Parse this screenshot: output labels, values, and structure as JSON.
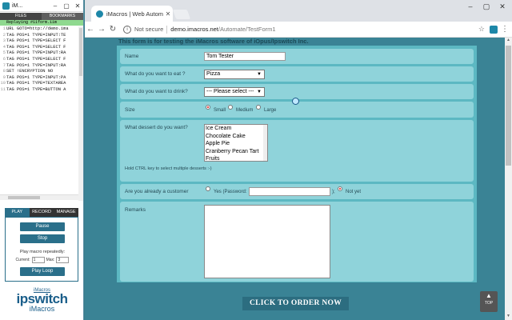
{
  "left_panel": {
    "title": "iM...",
    "tabs": [
      "FILES",
      "BOOKMARKS"
    ],
    "replay_line": "Replaying #11form.iim",
    "code_lines": [
      "URL GOTO=http://demo.ima",
      "TAG POS=1 TYPE=INPUT:TE",
      "TAG POS=1 TYPE=SELECT F",
      "TAG POS=1 TYPE=SELECT F",
      "TAG POS=1 TYPE=INPUT:RA",
      "TAG POS=1 TYPE=SELECT F",
      "TAG POS=1 TYPE=INPUT:RA",
      "SET !ENCRYPTION NO",
      "TAG POS=1 TYPE=INPUT:PA",
      "TAG POS=1 TYPE=TEXTAREA",
      "TAG POS=1 TYPE=BUTTON A"
    ],
    "line_numbers": [
      "1",
      "2",
      "3",
      "4",
      "5",
      "6",
      "7",
      "8",
      "9",
      "10",
      "11"
    ],
    "control_tabs": [
      "PLAY",
      "RECORD",
      "MANAGE"
    ],
    "pause_label": "Pause",
    "stop_label": "Stop",
    "play_repeat_label": "Play macro repeatedly:",
    "current_label": "Current:",
    "current_value": "1",
    "max_label": "Max:",
    "max_value": "3",
    "play_loop_label": "Play Loop",
    "brand_small": "iMacros",
    "brand_big": "ipswitch",
    "brand_sub": "iMacros"
  },
  "browser": {
    "tab_title": "iMacros | Web Automatio",
    "not_secure": "Not secure",
    "url_host": "demo.imacros.net",
    "url_path": "/Automate/TestForm1"
  },
  "form": {
    "intro": "This form is for testing the iMacros software of iOpus/Ipswitch Inc.",
    "name_label": "Name",
    "name_value": "Tom Tester",
    "eat_label": "What do you want to eat ?",
    "eat_value": "Pizza",
    "drink_label": "What do you want to drink?",
    "drink_value": "--- Please select ---",
    "size_label": "Size",
    "size_options": [
      "Small",
      "Medium",
      "Large"
    ],
    "size_selected": "Small",
    "dessert_label": "What dessert do you want?",
    "dessert_options": [
      "Ice Cream",
      "Chocolate Cake",
      "Apple Pie",
      "Cranberry Pecan Tart",
      "Fruits"
    ],
    "dessert_hint": "Hold CTRL key to select multiple desserts :-)",
    "customer_label": "Are you already a customer",
    "customer_yes": "Yes (Password:",
    "customer_sep": ");",
    "customer_no": "Not yet",
    "customer_selected": "Not yet",
    "remarks_label": "Remarks",
    "order_button": "CLICK TO ORDER NOW",
    "top_button": "TOP"
  },
  "colors": {
    "page_bg": "#3a8395",
    "panel_bg": "#5cb8c2",
    "row_bg": "#8fd3da",
    "button_bg": "#2c6d80",
    "brand": "#1a5e8a"
  }
}
